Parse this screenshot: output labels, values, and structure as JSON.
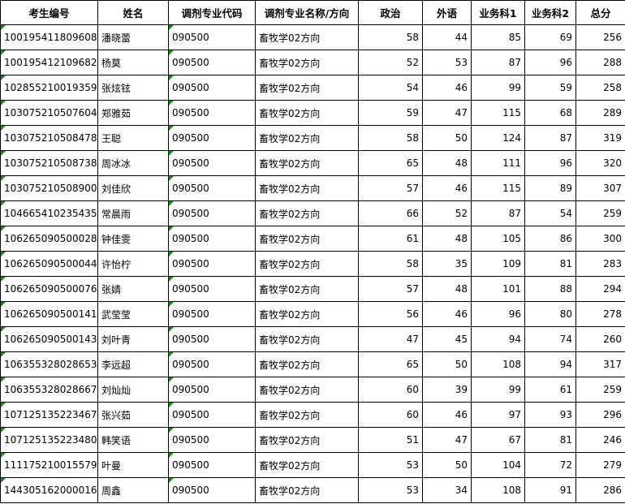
{
  "table": {
    "headers": [
      "考生编号",
      "姓名",
      "调剂专业代码",
      "调剂专业名称/方向",
      "政治",
      "外语",
      "业务科1",
      "业务科2",
      "总分"
    ],
    "rows": [
      [
        "100195411809608",
        "潘晓蕾",
        "090500",
        "畜牧学02方向",
        "58",
        "44",
        "85",
        "69",
        "256"
      ],
      [
        "100195412109682",
        "杨莫",
        "090500",
        "畜牧学02方向",
        "52",
        "53",
        "87",
        "96",
        "288"
      ],
      [
        "102855210019359",
        "张炫铉",
        "090500",
        "畜牧学02方向",
        "54",
        "46",
        "99",
        "59",
        "258"
      ],
      [
        "103075210507604",
        "郑雅茹",
        "090500",
        "畜牧学02方向",
        "59",
        "47",
        "115",
        "68",
        "289"
      ],
      [
        "103075210508478",
        "王聪",
        "090500",
        "畜牧学02方向",
        "58",
        "50",
        "124",
        "87",
        "319"
      ],
      [
        "103075210508738",
        "周冰冰",
        "090500",
        "畜牧学02方向",
        "65",
        "48",
        "111",
        "96",
        "320"
      ],
      [
        "103075210508900",
        "刘佳欣",
        "090500",
        "畜牧学02方向",
        "57",
        "46",
        "115",
        "89",
        "307"
      ],
      [
        "104665410235435",
        "常晨雨",
        "090500",
        "畜牧学02方向",
        "66",
        "52",
        "87",
        "54",
        "259"
      ],
      [
        "106265090500028",
        "钟佳雯",
        "090500",
        "畜牧学02方向",
        "61",
        "48",
        "105",
        "86",
        "300"
      ],
      [
        "106265090500044",
        "许怡柠",
        "090500",
        "畜牧学02方向",
        "58",
        "35",
        "109",
        "81",
        "283"
      ],
      [
        "106265090500076",
        "张婧",
        "090500",
        "畜牧学02方向",
        "57",
        "48",
        "101",
        "88",
        "294"
      ],
      [
        "106265090500141",
        "武莹莹",
        "090500",
        "畜牧学02方向",
        "56",
        "46",
        "96",
        "80",
        "278"
      ],
      [
        "106265090500143",
        "刘叶青",
        "090500",
        "畜牧学02方向",
        "47",
        "45",
        "94",
        "74",
        "260"
      ],
      [
        "106355328028653",
        "李远超",
        "090500",
        "畜牧学02方向",
        "65",
        "50",
        "108",
        "94",
        "317"
      ],
      [
        "106355328028667",
        "刘灿灿",
        "090500",
        "畜牧学02方向",
        "60",
        "39",
        "99",
        "61",
        "259"
      ],
      [
        "107125135223467",
        "张兴茹",
        "090500",
        "畜牧学02方向",
        "60",
        "46",
        "97",
        "93",
        "296"
      ],
      [
        "107125135223480",
        "韩笑语",
        "090500",
        "畜牧学02方向",
        "51",
        "47",
        "67",
        "81",
        "246"
      ],
      [
        "111175210015579",
        "叶曼",
        "090500",
        "畜牧学02方向",
        "53",
        "50",
        "104",
        "72",
        "279"
      ],
      [
        "144305162000016",
        "周鑫",
        "090500",
        "畜牧学02方向",
        "53",
        "34",
        "108",
        "91",
        "286"
      ]
    ]
  },
  "flag_color": "#1a8a1a"
}
